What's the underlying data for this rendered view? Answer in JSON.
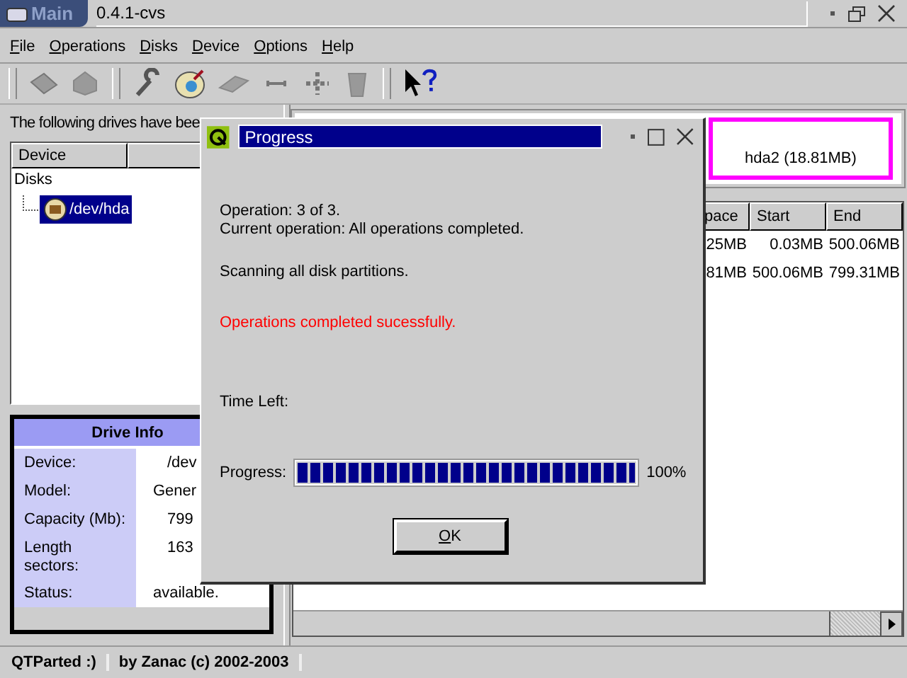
{
  "window": {
    "tab_label": "Main",
    "title": "0.4.1-cvs"
  },
  "menu": [
    "File",
    "Operations",
    "Disks",
    "Device",
    "Options",
    "Help"
  ],
  "detected_label": "The following drives have bee",
  "device_tree": {
    "columns": [
      "Device"
    ],
    "items": [
      {
        "label": "Disks",
        "expanded": true,
        "children": [
          {
            "label": "/dev/hda",
            "selected": true
          }
        ]
      }
    ]
  },
  "drive_info": {
    "title": "Drive Info",
    "rows": [
      {
        "label": "Device:",
        "value": "/dev"
      },
      {
        "label": "Model:",
        "value": "Gener"
      },
      {
        "label": "Capacity (Mb):",
        "value": "799"
      },
      {
        "label": "Length sectors:",
        "value": "163"
      },
      {
        "label": "Status:",
        "value": "available."
      }
    ]
  },
  "partition_map": {
    "partitions": [
      {
        "label": "hda2 (18.81MB)",
        "selected": true
      }
    ]
  },
  "partition_table": {
    "columns": [
      "pace",
      "Start",
      "End"
    ],
    "rows": [
      [
        "25MB",
        "0.03MB",
        "500.06MB"
      ],
      [
        "81MB",
        "500.06MB",
        "799.31MB"
      ]
    ]
  },
  "status_bar": [
    "QTParted :)",
    "by Zanac (c) 2002-2003"
  ],
  "dialog": {
    "title": "Progress",
    "lines": [
      "Operation: 3 of 3.",
      "Current operation: All operations completed."
    ],
    "scanning": "Scanning all disk partitions.",
    "result": "Operations completed sucessfully.",
    "time_left_label": "Time Left:",
    "progress_label": "Progress:",
    "level": 1,
    "percent": "100%",
    "ok_button": "OK"
  }
}
